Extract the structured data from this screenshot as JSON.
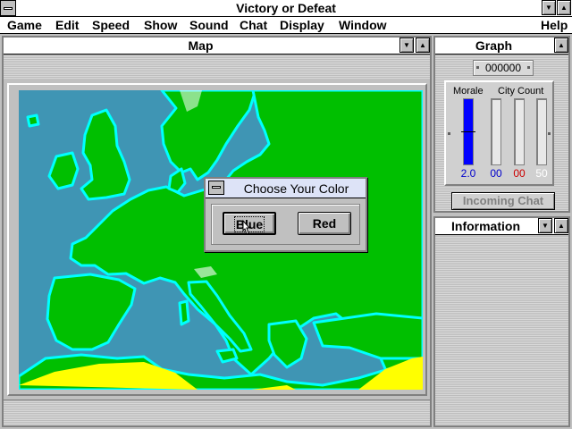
{
  "app": {
    "title": "Victory or Defeat"
  },
  "menu": [
    "Game",
    "Edit",
    "Speed",
    "Show",
    "Sound",
    "Chat",
    "Display",
    "Window",
    "Help"
  ],
  "map_pane": {
    "title": "Map"
  },
  "graph_pane": {
    "title": "Graph",
    "counter": "000000",
    "morale_label": "Morale",
    "city_count_label": "City Count",
    "values": [
      "2.0",
      "00",
      "00",
      "50"
    ],
    "value_colors": [
      "#0000cc",
      "#0000cc",
      "#cc0000",
      "#ffffff"
    ],
    "morale_fill_fraction": 1.0,
    "incoming_chat_label": "Incoming Chat"
  },
  "info_pane": {
    "title": "Information"
  },
  "dialog": {
    "title": "Choose Your Color",
    "blue_label": "Blue",
    "red_label": "Red"
  },
  "colors": {
    "sea": "#3f95b4",
    "land": "#00bf00",
    "coast": "#00ffff",
    "desert": "#ffff00",
    "morale_bar": "#0000ff"
  }
}
